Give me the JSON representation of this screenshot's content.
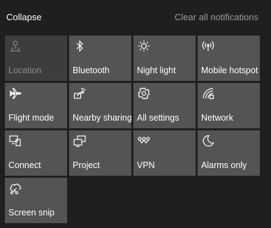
{
  "header": {
    "collapse_label": "Collapse",
    "clear_label": "Clear all notifications"
  },
  "tiles": [
    {
      "label": "Location",
      "icon": "location-icon",
      "state": "disabled"
    },
    {
      "label": "Bluetooth",
      "icon": "bluetooth-icon",
      "state": "available"
    },
    {
      "label": "Night light",
      "icon": "brightness-icon",
      "state": "available"
    },
    {
      "label": "Mobile hotspot",
      "icon": "hotspot-icon",
      "state": "available"
    },
    {
      "label": "Flight mode",
      "icon": "airplane-icon",
      "state": "available"
    },
    {
      "label": "Nearby sharing",
      "icon": "share-icon",
      "state": "available"
    },
    {
      "label": "All settings",
      "icon": "gear-icon",
      "state": "available"
    },
    {
      "label": "Network",
      "icon": "network-icon",
      "state": "available"
    },
    {
      "label": "Connect",
      "icon": "connect-icon",
      "state": "available"
    },
    {
      "label": "Project",
      "icon": "project-icon",
      "state": "available"
    },
    {
      "label": "VPN",
      "icon": "vpn-icon",
      "state": "available"
    },
    {
      "label": "Alarms only",
      "icon": "moon-icon",
      "state": "available"
    },
    {
      "label": "Screen snip",
      "icon": "screen-snip-icon",
      "state": "available"
    }
  ],
  "colors": {
    "background": "#1f1f1f",
    "tile": "#545454",
    "tile_disabled": "#3d3d3d",
    "text": "#ffffff",
    "text_muted": "#9a9a9a"
  }
}
